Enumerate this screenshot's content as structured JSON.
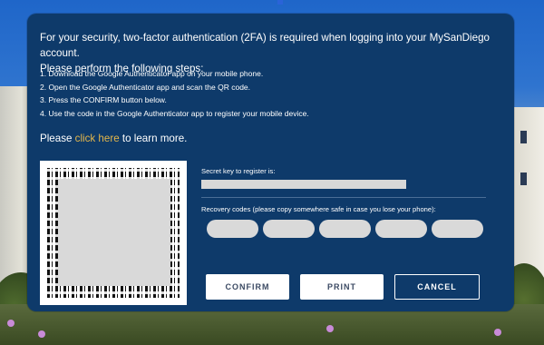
{
  "panel": {
    "intro_line1": "For your security, two-factor authentication (2FA) is required when logging into your MySanDiego account.",
    "intro_line2": "Please perform the following steps:",
    "steps": [
      "1. Download the Google Authenticator app on your mobile phone.",
      "2. Open the Google Authenticator app and scan the QR code.",
      "3. Press the CONFIRM button below.",
      "4. Use the code in the Google Authenticator app to register your mobile device."
    ],
    "learn_prefix": "Please ",
    "learn_link": "click here",
    "learn_suffix": " to learn more.",
    "secret_label": "Secret key to register is:",
    "recovery_label": "Recovery codes (please copy somewhere safe in case you lose your phone):",
    "buttons": {
      "confirm": "CONFIRM",
      "print": "PRINT",
      "cancel": "CANCEL"
    }
  },
  "colors": {
    "panel": "#0e3a6a",
    "link": "#e3b64b",
    "button_bg": "#ffffff",
    "redacted": "#d9d9d9"
  }
}
